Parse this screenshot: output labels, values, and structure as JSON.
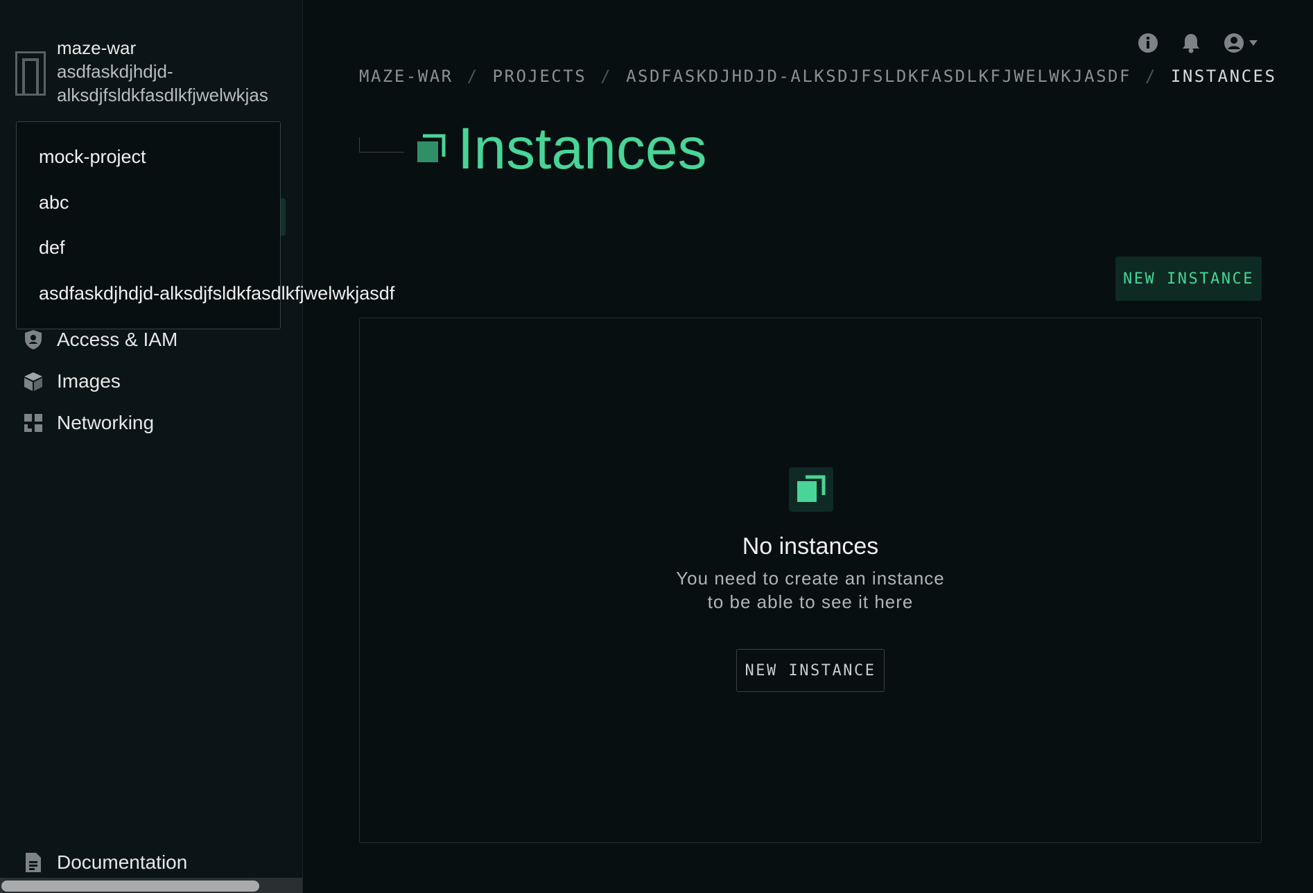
{
  "sidebar": {
    "org_name": "maze-war",
    "project_name_line1": "asdfaskdjhdjd-",
    "project_name_line2": "alksdjfsldkfasdlkfjwelwkjas",
    "nav": [
      {
        "label": "Access & IAM",
        "icon": "shield-icon"
      },
      {
        "label": "Images",
        "icon": "cube-icon"
      },
      {
        "label": "Networking",
        "icon": "grid-icon"
      }
    ],
    "footer": {
      "label": "Documentation",
      "icon": "document-icon"
    }
  },
  "project_dropdown": {
    "options": [
      "mock-project",
      "abc",
      "def",
      "asdfaskdjhdjd-alksdjfsldkfasdlkfjwelwkjasdf"
    ]
  },
  "header": {
    "icons": [
      "info-icon",
      "bell-icon",
      "user-icon"
    ]
  },
  "breadcrumb": [
    "MAZE-WAR",
    "PROJECTS",
    "ASDFASKDJHDJD-ALKSDJFSLDKFASDLKFJWELWKJASDF",
    "INSTANCES"
  ],
  "breadcrumb_separator": "/",
  "page": {
    "title": "Instances",
    "new_button": "NEW INSTANCE"
  },
  "empty_state": {
    "title": "No instances",
    "desc_line1": "You need to create an instance",
    "desc_line2": "to be able to see it here",
    "button": "NEW INSTANCE"
  },
  "colors": {
    "accent": "#48d597",
    "accent_bg": "#0d2a23",
    "background": "#080f11",
    "sidebar": "#0b1416"
  }
}
